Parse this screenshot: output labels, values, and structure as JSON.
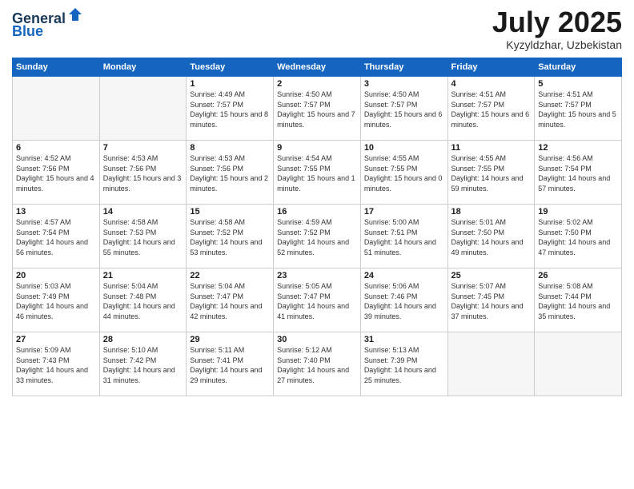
{
  "header": {
    "logo_general": "General",
    "logo_blue": "Blue",
    "month_title": "July 2025",
    "location": "Kyzyldzhar, Uzbekistan"
  },
  "days_of_week": [
    "Sunday",
    "Monday",
    "Tuesday",
    "Wednesday",
    "Thursday",
    "Friday",
    "Saturday"
  ],
  "weeks": [
    [
      {
        "day": "",
        "info": ""
      },
      {
        "day": "",
        "info": ""
      },
      {
        "day": "1",
        "info": "Sunrise: 4:49 AM\nSunset: 7:57 PM\nDaylight: 15 hours and 8 minutes."
      },
      {
        "day": "2",
        "info": "Sunrise: 4:50 AM\nSunset: 7:57 PM\nDaylight: 15 hours and 7 minutes."
      },
      {
        "day": "3",
        "info": "Sunrise: 4:50 AM\nSunset: 7:57 PM\nDaylight: 15 hours and 6 minutes."
      },
      {
        "day": "4",
        "info": "Sunrise: 4:51 AM\nSunset: 7:57 PM\nDaylight: 15 hours and 6 minutes."
      },
      {
        "day": "5",
        "info": "Sunrise: 4:51 AM\nSunset: 7:57 PM\nDaylight: 15 hours and 5 minutes."
      }
    ],
    [
      {
        "day": "6",
        "info": "Sunrise: 4:52 AM\nSunset: 7:56 PM\nDaylight: 15 hours and 4 minutes."
      },
      {
        "day": "7",
        "info": "Sunrise: 4:53 AM\nSunset: 7:56 PM\nDaylight: 15 hours and 3 minutes."
      },
      {
        "day": "8",
        "info": "Sunrise: 4:53 AM\nSunset: 7:56 PM\nDaylight: 15 hours and 2 minutes."
      },
      {
        "day": "9",
        "info": "Sunrise: 4:54 AM\nSunset: 7:55 PM\nDaylight: 15 hours and 1 minute."
      },
      {
        "day": "10",
        "info": "Sunrise: 4:55 AM\nSunset: 7:55 PM\nDaylight: 15 hours and 0 minutes."
      },
      {
        "day": "11",
        "info": "Sunrise: 4:55 AM\nSunset: 7:55 PM\nDaylight: 14 hours and 59 minutes."
      },
      {
        "day": "12",
        "info": "Sunrise: 4:56 AM\nSunset: 7:54 PM\nDaylight: 14 hours and 57 minutes."
      }
    ],
    [
      {
        "day": "13",
        "info": "Sunrise: 4:57 AM\nSunset: 7:54 PM\nDaylight: 14 hours and 56 minutes."
      },
      {
        "day": "14",
        "info": "Sunrise: 4:58 AM\nSunset: 7:53 PM\nDaylight: 14 hours and 55 minutes."
      },
      {
        "day": "15",
        "info": "Sunrise: 4:58 AM\nSunset: 7:52 PM\nDaylight: 14 hours and 53 minutes."
      },
      {
        "day": "16",
        "info": "Sunrise: 4:59 AM\nSunset: 7:52 PM\nDaylight: 14 hours and 52 minutes."
      },
      {
        "day": "17",
        "info": "Sunrise: 5:00 AM\nSunset: 7:51 PM\nDaylight: 14 hours and 51 minutes."
      },
      {
        "day": "18",
        "info": "Sunrise: 5:01 AM\nSunset: 7:50 PM\nDaylight: 14 hours and 49 minutes."
      },
      {
        "day": "19",
        "info": "Sunrise: 5:02 AM\nSunset: 7:50 PM\nDaylight: 14 hours and 47 minutes."
      }
    ],
    [
      {
        "day": "20",
        "info": "Sunrise: 5:03 AM\nSunset: 7:49 PM\nDaylight: 14 hours and 46 minutes."
      },
      {
        "day": "21",
        "info": "Sunrise: 5:04 AM\nSunset: 7:48 PM\nDaylight: 14 hours and 44 minutes."
      },
      {
        "day": "22",
        "info": "Sunrise: 5:04 AM\nSunset: 7:47 PM\nDaylight: 14 hours and 42 minutes."
      },
      {
        "day": "23",
        "info": "Sunrise: 5:05 AM\nSunset: 7:47 PM\nDaylight: 14 hours and 41 minutes."
      },
      {
        "day": "24",
        "info": "Sunrise: 5:06 AM\nSunset: 7:46 PM\nDaylight: 14 hours and 39 minutes."
      },
      {
        "day": "25",
        "info": "Sunrise: 5:07 AM\nSunset: 7:45 PM\nDaylight: 14 hours and 37 minutes."
      },
      {
        "day": "26",
        "info": "Sunrise: 5:08 AM\nSunset: 7:44 PM\nDaylight: 14 hours and 35 minutes."
      }
    ],
    [
      {
        "day": "27",
        "info": "Sunrise: 5:09 AM\nSunset: 7:43 PM\nDaylight: 14 hours and 33 minutes."
      },
      {
        "day": "28",
        "info": "Sunrise: 5:10 AM\nSunset: 7:42 PM\nDaylight: 14 hours and 31 minutes."
      },
      {
        "day": "29",
        "info": "Sunrise: 5:11 AM\nSunset: 7:41 PM\nDaylight: 14 hours and 29 minutes."
      },
      {
        "day": "30",
        "info": "Sunrise: 5:12 AM\nSunset: 7:40 PM\nDaylight: 14 hours and 27 minutes."
      },
      {
        "day": "31",
        "info": "Sunrise: 5:13 AM\nSunset: 7:39 PM\nDaylight: 14 hours and 25 minutes."
      },
      {
        "day": "",
        "info": ""
      },
      {
        "day": "",
        "info": ""
      }
    ]
  ]
}
